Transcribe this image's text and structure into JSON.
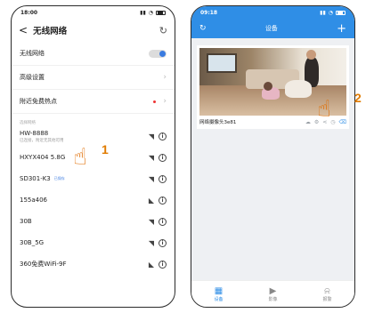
{
  "left_phone": {
    "status_time": "18:00",
    "header": {
      "back": "<",
      "title": "无线网络",
      "refresh_icon": "refresh-icon"
    },
    "settings": [
      {
        "label": "无线网络"
      },
      {
        "label": "高级设置"
      },
      {
        "label": "附近免费热点"
      }
    ],
    "section_label": "选择网络",
    "networks": [
      {
        "name": "HW-8888",
        "sub": "已连接，附近无其他可用"
      },
      {
        "name": "HXYX404 5.8G"
      },
      {
        "name": "SD301-K3",
        "badge": "已保存"
      },
      {
        "name": "155a406"
      },
      {
        "name": "30B"
      },
      {
        "name": "30B_5G"
      },
      {
        "name": "360免费WiFi-9F"
      }
    ]
  },
  "right_phone": {
    "status_time": "09:18",
    "header": {
      "title": "设备"
    },
    "camera_name": "网络摄像头3e81",
    "tabs": [
      {
        "label": "设备"
      },
      {
        "label": "影像"
      },
      {
        "label": "报警"
      }
    ]
  },
  "annotations": {
    "step1": "1",
    "step2": "2"
  },
  "colors": {
    "accent": "#2f8ee6",
    "callout": "#e07b00"
  }
}
